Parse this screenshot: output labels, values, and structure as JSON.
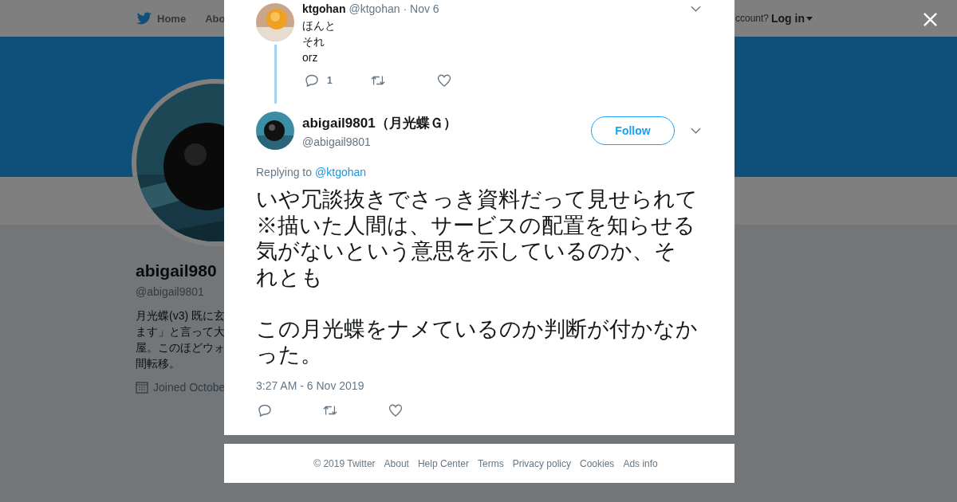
{
  "background_page": {
    "nav": [
      "Home",
      "Abo"
    ],
    "login_prompt": "ccount?",
    "login": "Log in",
    "profile": {
      "name": "abigail980",
      "handle": "@abigail9801",
      "bio": [
        "月光蝶(v3) 既に玄",
        "ます」と言って大",
        "屋。このほどウォ",
        "間転移。"
      ],
      "joined": "Joined Octobe"
    }
  },
  "parent_tweet": {
    "name": "ktgohan",
    "handle": "@ktgohan",
    "date": "· Nov 6",
    "lines": [
      "ほんと",
      "それ",
      "orz"
    ],
    "reply_count": "1"
  },
  "tweet": {
    "name": "abigail9801（月光蝶Ｇ）",
    "handle": "@abigail9801",
    "follow": "Follow",
    "replying_label": "Replying to",
    "replying_to": "@ktgohan",
    "paragraphs": [
      [
        "いや冗談抜きでさっき資料だって見せられて",
        "※描いた人間は、サービスの配置を知らせる",
        "気がないという意思を示しているのか、そ",
        "れとも"
      ],
      [
        "この月光蝶をナメているのか判断が付かなか",
        "った。"
      ]
    ],
    "timestamp": "3:27 AM - 6 Nov 2019"
  },
  "footer": [
    "© 2019 Twitter",
    "About",
    "Help Center",
    "Terms",
    "Privacy policy",
    "Cookies",
    "Ads info"
  ]
}
